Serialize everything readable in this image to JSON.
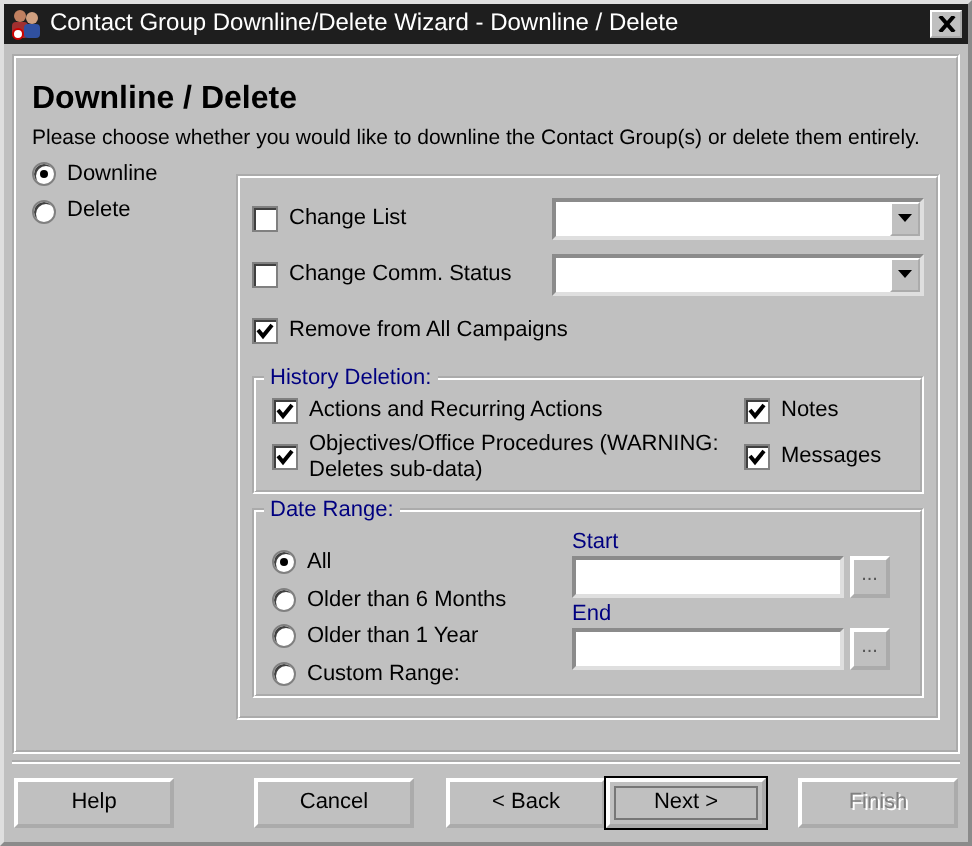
{
  "window": {
    "title": "Contact Group Downline/Delete Wizard - Downline / Delete"
  },
  "header": {
    "title": "Downline / Delete",
    "description": "Please choose whether you would like to downline the Contact Group(s) or delete them entirely."
  },
  "modes": [
    {
      "label": "Downline",
      "selected": true
    },
    {
      "label": "Delete",
      "selected": false
    }
  ],
  "options": [
    {
      "kind": "dropdown",
      "label": "Change List",
      "checked": false
    },
    {
      "kind": "dropdown",
      "label": "Change Comm. Status",
      "checked": false
    },
    {
      "kind": "check",
      "label": "Remove from All Campaigns",
      "checked": true
    }
  ],
  "history_deletion": {
    "title": "History Deletion:",
    "items": [
      {
        "label": "Actions and Recurring Actions",
        "checked": true
      },
      {
        "label": "Notes",
        "checked": true
      },
      {
        "label": "Objectives/Office Procedures  (WARNING: Deletes sub-data)",
        "checked": true
      },
      {
        "label": "Messages",
        "checked": true
      }
    ]
  },
  "date_range": {
    "title": "Date Range:",
    "options": [
      {
        "label": "All",
        "selected": true
      },
      {
        "label": "Older than 6 Months",
        "selected": false
      },
      {
        "label": "Older than 1 Year",
        "selected": false
      },
      {
        "label": "Custom Range:",
        "selected": false
      }
    ],
    "fields": [
      {
        "label": "Start",
        "button": "..."
      },
      {
        "label": "End",
        "button": "..."
      }
    ]
  },
  "buttons": [
    {
      "label": "Help",
      "disabled": false,
      "default": false
    },
    {
      "label": "Cancel",
      "disabled": false,
      "default": false
    },
    {
      "label": "< Back",
      "disabled": false,
      "default": false
    },
    {
      "label": "Next >",
      "disabled": false,
      "default": true
    },
    {
      "label": "Finish",
      "disabled": true,
      "default": false
    }
  ]
}
